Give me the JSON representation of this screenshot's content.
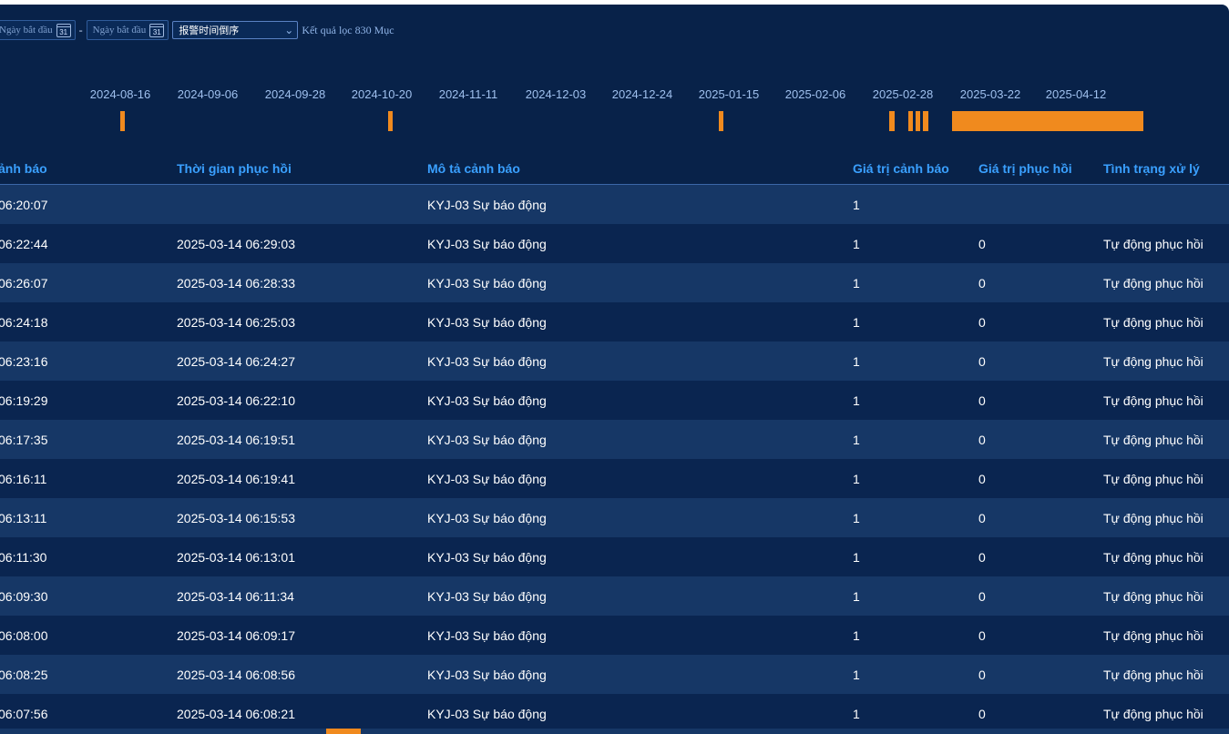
{
  "filters": {
    "start_date_placeholder": "Ngày bắt đầu",
    "end_date_placeholder": "Ngày bắt đầu",
    "calendar_day": "31",
    "separator": "-",
    "sort_selected": "报警时间倒序",
    "result_count": "Kết quả lọc 830 Mục"
  },
  "timeline": {
    "labels": [
      "2024-08-16",
      "2024-09-06",
      "2024-09-28",
      "2024-10-20",
      "2024-11-11",
      "2024-12-03",
      "2024-12-24",
      "2025-01-15",
      "2025-02-06",
      "2025-02-28",
      "2025-03-22",
      "2025-04-12"
    ],
    "bar_color": "#f08a1e"
  },
  "table": {
    "headers": [
      "ảnh báo",
      "Thời gian phục hồi",
      "Mô tả cảnh báo",
      "Giá trị cảnh báo",
      "Giá trị phục hồi",
      "Tình trạng xử lý"
    ],
    "rows": [
      [
        "06:20:07",
        "",
        "KYJ-03 Sự báo động",
        "1",
        "",
        ""
      ],
      [
        "06:22:44",
        "2025-03-14 06:29:03",
        "KYJ-03 Sự báo động",
        "1",
        "0",
        "Tự động phục hồi"
      ],
      [
        "06:26:07",
        "2025-03-14 06:28:33",
        "KYJ-03 Sự báo động",
        "1",
        "0",
        "Tự động phục hồi"
      ],
      [
        "06:24:18",
        "2025-03-14 06:25:03",
        "KYJ-03 Sự báo động",
        "1",
        "0",
        "Tự động phục hồi"
      ],
      [
        "06:23:16",
        "2025-03-14 06:24:27",
        "KYJ-03 Sự báo động",
        "1",
        "0",
        "Tự động phục hồi"
      ],
      [
        "06:19:29",
        "2025-03-14 06:22:10",
        "KYJ-03 Sự báo động",
        "1",
        "0",
        "Tự động phục hồi"
      ],
      [
        "06:17:35",
        "2025-03-14 06:19:51",
        "KYJ-03 Sự báo động",
        "1",
        "0",
        "Tự động phục hồi"
      ],
      [
        "06:16:11",
        "2025-03-14 06:19:41",
        "KYJ-03 Sự báo động",
        "1",
        "0",
        "Tự động phục hồi"
      ],
      [
        "06:13:11",
        "2025-03-14 06:15:53",
        "KYJ-03 Sự báo động",
        "1",
        "0",
        "Tự động phục hồi"
      ],
      [
        "06:11:30",
        "2025-03-14 06:13:01",
        "KYJ-03 Sự báo động",
        "1",
        "0",
        "Tự động phục hồi"
      ],
      [
        "06:09:30",
        "2025-03-14 06:11:34",
        "KYJ-03 Sự báo động",
        "1",
        "0",
        "Tự động phục hồi"
      ],
      [
        "06:08:00",
        "2025-03-14 06:09:17",
        "KYJ-03 Sự báo động",
        "1",
        "0",
        "Tự động phục hồi"
      ],
      [
        "06:08:25",
        "2025-03-14 06:08:56",
        "KYJ-03 Sự báo động",
        "1",
        "0",
        "Tự động phục hồi"
      ],
      [
        "06:07:56",
        "2025-03-14 06:08:21",
        "KYJ-03 Sự báo động",
        "1",
        "0",
        "Tự động phục hồi"
      ]
    ]
  }
}
